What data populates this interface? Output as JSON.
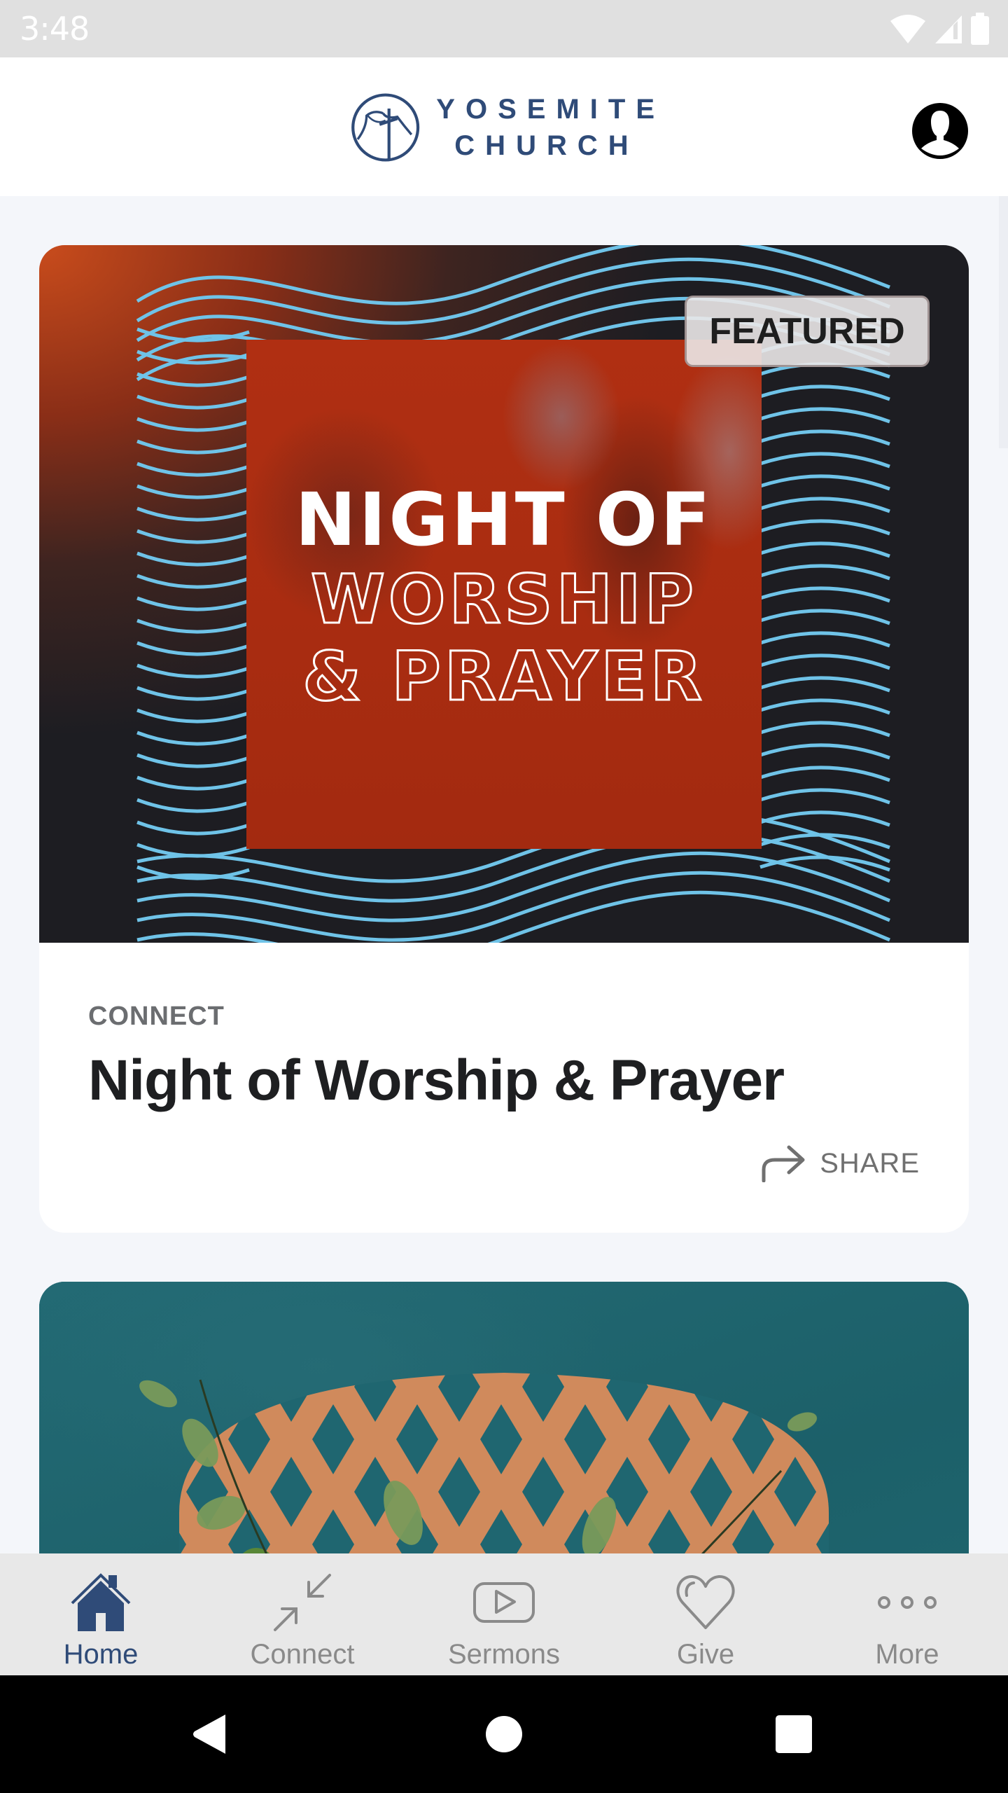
{
  "status_bar": {
    "time": "3:48",
    "icons": [
      "wifi-icon",
      "cell-signal-icon",
      "battery-icon"
    ]
  },
  "header": {
    "logo_line1": "YOSEMITE",
    "logo_line2": "CHURCH",
    "profile_icon": "account-circle-icon"
  },
  "feed": {
    "cards": [
      {
        "badge": "FEATURED",
        "poster_line1": "NIGHT OF",
        "poster_line2": "WORSHIP",
        "poster_line3": "& PRAYER",
        "category": "CONNECT",
        "title": "Night of Worship & Prayer",
        "share_label": "SHARE"
      },
      {
        "image_description": "teal background with orange lattice, eucalyptus leaves and open book"
      }
    ]
  },
  "tab_bar": {
    "active": "Home",
    "tabs": [
      {
        "label": "Home",
        "icon": "home-icon"
      },
      {
        "label": "Connect",
        "icon": "connect-arrows-icon"
      },
      {
        "label": "Sermons",
        "icon": "play-video-icon"
      },
      {
        "label": "Give",
        "icon": "heart-icon"
      },
      {
        "label": "More",
        "icon": "more-dots-icon"
      }
    ]
  },
  "colors": {
    "brand": "#2f4b78",
    "inactive_tab": "#8a8a8a",
    "page_background": "#f4f6fa",
    "wave_lines": "#6fc3e8"
  }
}
